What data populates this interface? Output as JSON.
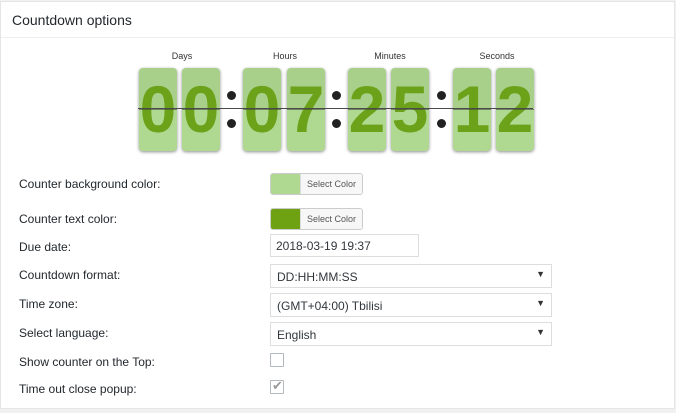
{
  "panel": {
    "title": "Countdown options"
  },
  "counter": {
    "labels": {
      "days": "Days",
      "hours": "Hours",
      "minutes": "Minutes",
      "seconds": "Seconds"
    },
    "digits": {
      "d1": "0",
      "d2": "0",
      "h1": "0",
      "h2": "7",
      "m1": "2",
      "m2": "5",
      "s1": "1",
      "s2": "2"
    },
    "background_color": "#afd891",
    "text_color": "#6ca219"
  },
  "form": {
    "bg_color_label": "Counter background color:",
    "bg_color_button": "Select Color",
    "text_color_label": "Counter text color:",
    "text_color_button": "Select Color",
    "text_color_swatch": "#6ea212",
    "due_date_label": "Due date:",
    "due_date_value": "2018-03-19 19:37",
    "format_label": "Countdown format:",
    "format_value": "DD:HH:MM:SS",
    "timezone_label": "Time zone:",
    "timezone_value": "(GMT+04:00) Tbilisi",
    "language_label": "Select language:",
    "language_value": "English",
    "show_top_label": "Show counter on the Top:",
    "show_top_checked": false,
    "timeout_label": "Time out close popup:",
    "timeout_checked": true
  }
}
